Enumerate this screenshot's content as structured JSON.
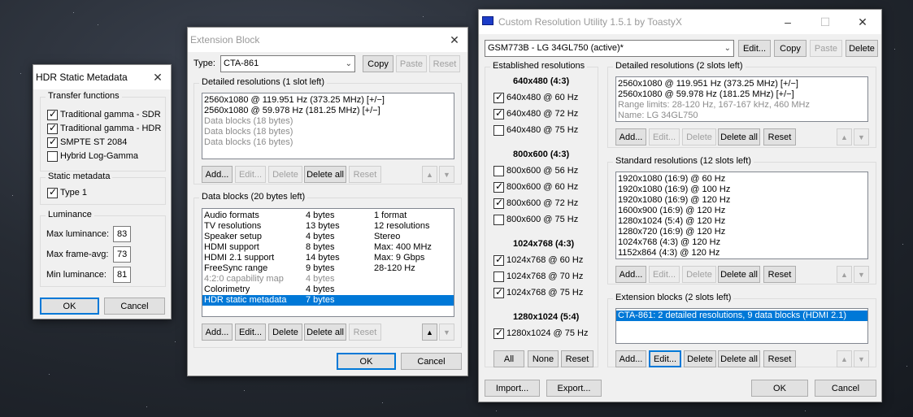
{
  "hdr_window": {
    "title": "HDR Static Metadata",
    "transfer_label": "Transfer functions",
    "transfer": [
      {
        "label": "Traditional gamma - SDR",
        "checked": true
      },
      {
        "label": "Traditional gamma - HDR",
        "checked": true
      },
      {
        "label": "SMPTE ST 2084",
        "checked": true
      },
      {
        "label": "Hybrid Log-Gamma",
        "checked": false
      }
    ],
    "static_label": "Static metadata",
    "type1_label": "Type 1",
    "luminance_label": "Luminance",
    "max_lum_label": "Max luminance:",
    "max_lum_value": "83",
    "max_avg_label": "Max frame-avg:",
    "max_avg_value": "73",
    "min_lum_label": "Min luminance:",
    "min_lum_value": "81",
    "ok": "OK",
    "cancel": "Cancel"
  },
  "ext_window": {
    "title": "Extension Block",
    "type_label": "Type:",
    "type_value": "CTA-861",
    "copy": "Copy",
    "paste": "Paste",
    "reset": "Reset",
    "detailed_label": "Detailed resolutions (1 slot left)",
    "detailed_items": [
      {
        "text": "2560x1080 @ 119.951 Hz (373.25 MHz) [+/−]",
        "gray": false
      },
      {
        "text": "2560x1080 @ 59.978 Hz (181.25 MHz) [+/−]",
        "gray": false
      },
      {
        "text": "Data blocks (18 bytes)",
        "gray": true
      },
      {
        "text": "Data blocks (18 bytes)",
        "gray": true
      },
      {
        "text": "Data blocks (16 bytes)",
        "gray": true
      }
    ],
    "add": "Add...",
    "edit": "Edit...",
    "delete": "Delete",
    "delete_all": "Delete all",
    "datablocks_label": "Data blocks (20 bytes left)",
    "datablocks": [
      {
        "name": "Audio formats",
        "size": "4 bytes",
        "info": "1 format",
        "gray": false,
        "selected": false
      },
      {
        "name": "TV resolutions",
        "size": "13 bytes",
        "info": "12 resolutions",
        "gray": false,
        "selected": false
      },
      {
        "name": "Speaker setup",
        "size": "4 bytes",
        "info": "Stereo",
        "gray": false,
        "selected": false
      },
      {
        "name": "HDMI support",
        "size": "8 bytes",
        "info": "Max: 400 MHz",
        "gray": false,
        "selected": false
      },
      {
        "name": "HDMI 2.1 support",
        "size": "14 bytes",
        "info": "Max: 9 Gbps",
        "gray": false,
        "selected": false
      },
      {
        "name": "FreeSync range",
        "size": "9 bytes",
        "info": "28-120 Hz",
        "gray": false,
        "selected": false
      },
      {
        "name": "4:2:0 capability map",
        "size": "4 bytes",
        "info": "",
        "gray": true,
        "selected": false
      },
      {
        "name": "Colorimetry",
        "size": "4 bytes",
        "info": "",
        "gray": false,
        "selected": false
      },
      {
        "name": "HDR static metadata",
        "size": "7 bytes",
        "info": "",
        "gray": false,
        "selected": true
      }
    ],
    "ok": "OK",
    "cancel": "Cancel"
  },
  "cru_window": {
    "title": "Custom Resolution Utility 1.5.1 by ToastyX",
    "monitor": "GSM773B - LG 34GL750 (active)*",
    "edit": "Edit...",
    "copy": "Copy",
    "paste": "Paste",
    "delete": "Delete",
    "established_label": "Established resolutions",
    "est_groups": [
      {
        "header": "640x480 (4:3)",
        "items": [
          {
            "label": "640x480 @ 60 Hz",
            "checked": true
          },
          {
            "label": "640x480 @ 72 Hz",
            "checked": true
          },
          {
            "label": "640x480 @ 75 Hz",
            "checked": false
          }
        ]
      },
      {
        "header": "800x600 (4:3)",
        "items": [
          {
            "label": "800x600 @ 56 Hz",
            "checked": false
          },
          {
            "label": "800x600 @ 60 Hz",
            "checked": true
          },
          {
            "label": "800x600 @ 72 Hz",
            "checked": true
          },
          {
            "label": "800x600 @ 75 Hz",
            "checked": false
          }
        ]
      },
      {
        "header": "1024x768 (4:3)",
        "items": [
          {
            "label": "1024x768 @ 60 Hz",
            "checked": true
          },
          {
            "label": "1024x768 @ 70 Hz",
            "checked": false
          },
          {
            "label": "1024x768 @ 75 Hz",
            "checked": true
          }
        ]
      },
      {
        "header": "1280x1024 (5:4)",
        "items": [
          {
            "label": "1280x1024 @ 75 Hz",
            "checked": true
          }
        ]
      }
    ],
    "all": "All",
    "none": "None",
    "reset": "Reset",
    "detailed_label": "Detailed resolutions (2 slots left)",
    "detailed_items": [
      {
        "text": "2560x1080 @ 119.951 Hz (373.25 MHz) [+/−]",
        "gray": false
      },
      {
        "text": "2560x1080 @ 59.978 Hz (181.25 MHz) [+/−]",
        "gray": false
      },
      {
        "text": "Range limits: 28-120 Hz, 167-167 kHz, 460 MHz",
        "gray": true
      },
      {
        "text": "Name: LG 34GL750",
        "gray": true
      }
    ],
    "standard_label": "Standard resolutions (12 slots left)",
    "standard_items": [
      "1920x1080 (16:9) @ 60 Hz",
      "1920x1080 (16:9) @ 100 Hz",
      "1920x1080 (16:9) @ 120 Hz",
      "1600x900 (16:9) @ 120 Hz",
      "1280x1024 (5:4) @ 120 Hz",
      "1280x720 (16:9) @ 120 Hz",
      "1024x768 (4:3) @ 120 Hz",
      "1152x864 (4:3) @ 120 Hz"
    ],
    "extension_label": "Extension blocks (2 slots left)",
    "extension_items": [
      "CTA-861: 2 detailed resolutions, 9 data blocks (HDMI 2.1)"
    ],
    "add": "Add...",
    "delete_all": "Delete all",
    "import": "Import...",
    "export": "Export...",
    "ok": "OK",
    "cancel": "Cancel"
  }
}
